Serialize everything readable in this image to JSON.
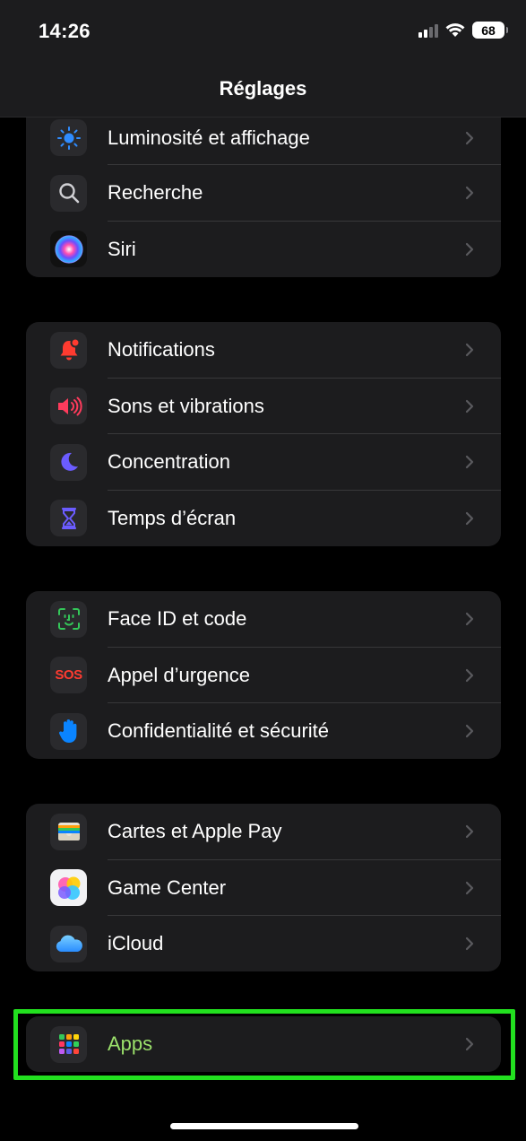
{
  "status": {
    "time": "14:26",
    "battery": "68"
  },
  "header": {
    "title": "Réglages"
  },
  "groups": [
    {
      "items": [
        {
          "label": "Luminosité et affichage",
          "icon": "brightness-icon"
        },
        {
          "label": "Recherche",
          "icon": "search-icon"
        },
        {
          "label": "Siri",
          "icon": "siri-icon"
        }
      ]
    },
    {
      "items": [
        {
          "label": "Notifications",
          "icon": "bell-icon"
        },
        {
          "label": "Sons et vibrations",
          "icon": "speaker-icon"
        },
        {
          "label": "Concentration",
          "icon": "moon-icon"
        },
        {
          "label": "Temps d’écran",
          "icon": "hourglass-icon"
        }
      ]
    },
    {
      "items": [
        {
          "label": "Face ID et code",
          "icon": "faceid-icon"
        },
        {
          "label": "Appel d’urgence",
          "icon": "sos-icon",
          "icon_text": "SOS"
        },
        {
          "label": "Confidentialité et sécurité",
          "icon": "hand-icon"
        }
      ]
    },
    {
      "items": [
        {
          "label": "Cartes et Apple Pay",
          "icon": "wallet-icon"
        },
        {
          "label": "Game Center",
          "icon": "game-center-icon"
        },
        {
          "label": "iCloud",
          "icon": "cloud-icon"
        }
      ]
    },
    {
      "items": [
        {
          "label": "Apps",
          "icon": "apps-grid-icon"
        }
      ]
    }
  ],
  "colors": {
    "highlight": "#22e01f",
    "apps_label": "#9be16b"
  }
}
